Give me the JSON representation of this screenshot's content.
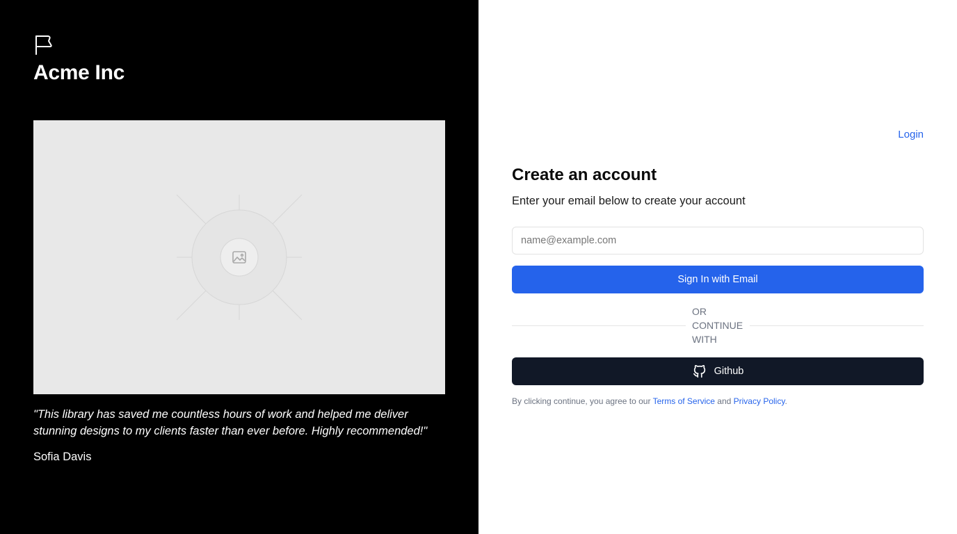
{
  "brand": {
    "name": "Acme Inc",
    "logo_icon": "flag-icon"
  },
  "testimonial": {
    "quote": "\"This library has saved me countless hours of work and helped me deliver stunning designs to my clients faster than ever before. Highly recommended!\"",
    "author": "Sofia Davis"
  },
  "hero": {
    "icon": "image-placeholder-icon"
  },
  "header": {
    "login_label": "Login"
  },
  "form": {
    "title": "Create an account",
    "subtitle": "Enter your email below to create your account",
    "email_placeholder": "name@example.com",
    "email_value": "",
    "submit_label": "Sign In with Email",
    "divider_text": "Or continue with",
    "github_label": "Github",
    "github_icon": "github-icon"
  },
  "legal": {
    "prefix": "By clicking continue, you agree to our ",
    "terms_label": "Terms of Service",
    "middle": " and ",
    "privacy_label": "Privacy Policy",
    "suffix": "."
  },
  "colors": {
    "primary": "#2563eb",
    "github_button": "#111827",
    "left_panel": "#000000",
    "hero_bg": "#e8e8e8"
  }
}
